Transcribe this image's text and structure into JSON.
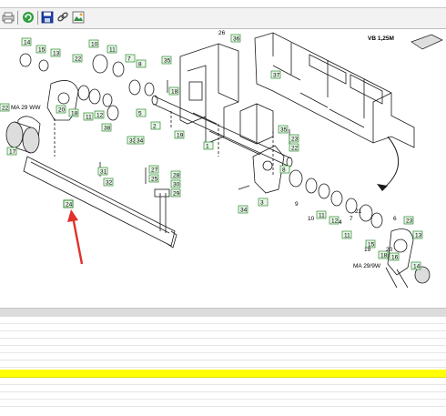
{
  "toolbar": {
    "buttons": [
      {
        "name": "print-button",
        "icon": "printer-icon"
      },
      {
        "name": "refresh-button",
        "icon": "refresh-icon"
      },
      {
        "name": "save-button",
        "icon": "floppy-disk-icon"
      },
      {
        "name": "link-button",
        "icon": "chain-link-icon"
      },
      {
        "name": "image-button",
        "icon": "picture-icon"
      }
    ]
  },
  "drawing": {
    "model_label": "VB 1,25M",
    "ref_codes": [
      "MA 29 WW",
      "MA 29/9W"
    ],
    "part_callouts": [
      "1",
      "2",
      "3",
      "4",
      "5",
      "6",
      "7",
      "8",
      "9",
      "10",
      "11",
      "12",
      "13",
      "14",
      "15",
      "16",
      "17",
      "18",
      "19",
      "20",
      "21",
      "22",
      "23",
      "24",
      "25",
      "26",
      "27",
      "28",
      "29",
      "30",
      "31",
      "32",
      "33",
      "34",
      "35",
      "36",
      "37",
      "38"
    ],
    "highlighted_part": "24"
  },
  "parts_list": {
    "selected_row_index": 9,
    "row_count": 12
  },
  "colors": {
    "selected_row": "#ffff00",
    "callout_border": "#2c8a2c",
    "arrow": "#e0312b",
    "toolbar_bg": "#f2f2f2"
  }
}
